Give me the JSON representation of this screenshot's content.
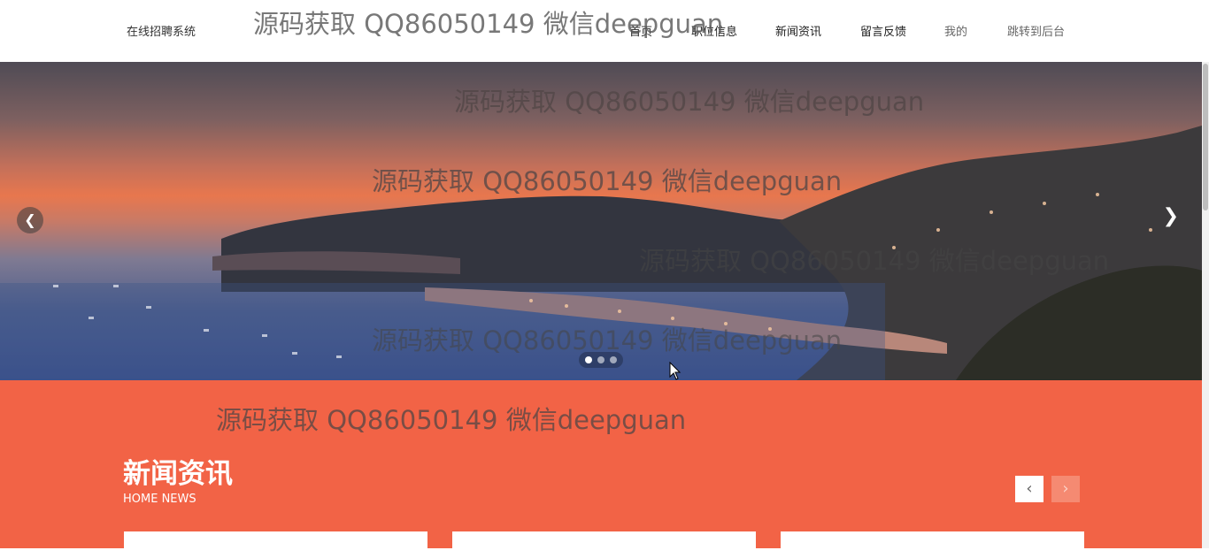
{
  "header": {
    "logo": "在线招聘系统",
    "nav": [
      "首页",
      "职位信息",
      "新闻资讯",
      "留言反馈",
      "我的",
      "跳转到后台"
    ]
  },
  "banner": {
    "prev_icon": "chevron-left-icon",
    "next_icon": "chevron-right-icon",
    "slide_count": 3,
    "active_slide": 1
  },
  "news": {
    "title": "新闻资讯",
    "subtitle": "HOME NEWS",
    "prev_icon": "chevron-left-icon",
    "next_icon": "chevron-right-icon",
    "accent": "#f26346"
  },
  "watermark": "源码获取 QQ86050149 微信deepguan"
}
